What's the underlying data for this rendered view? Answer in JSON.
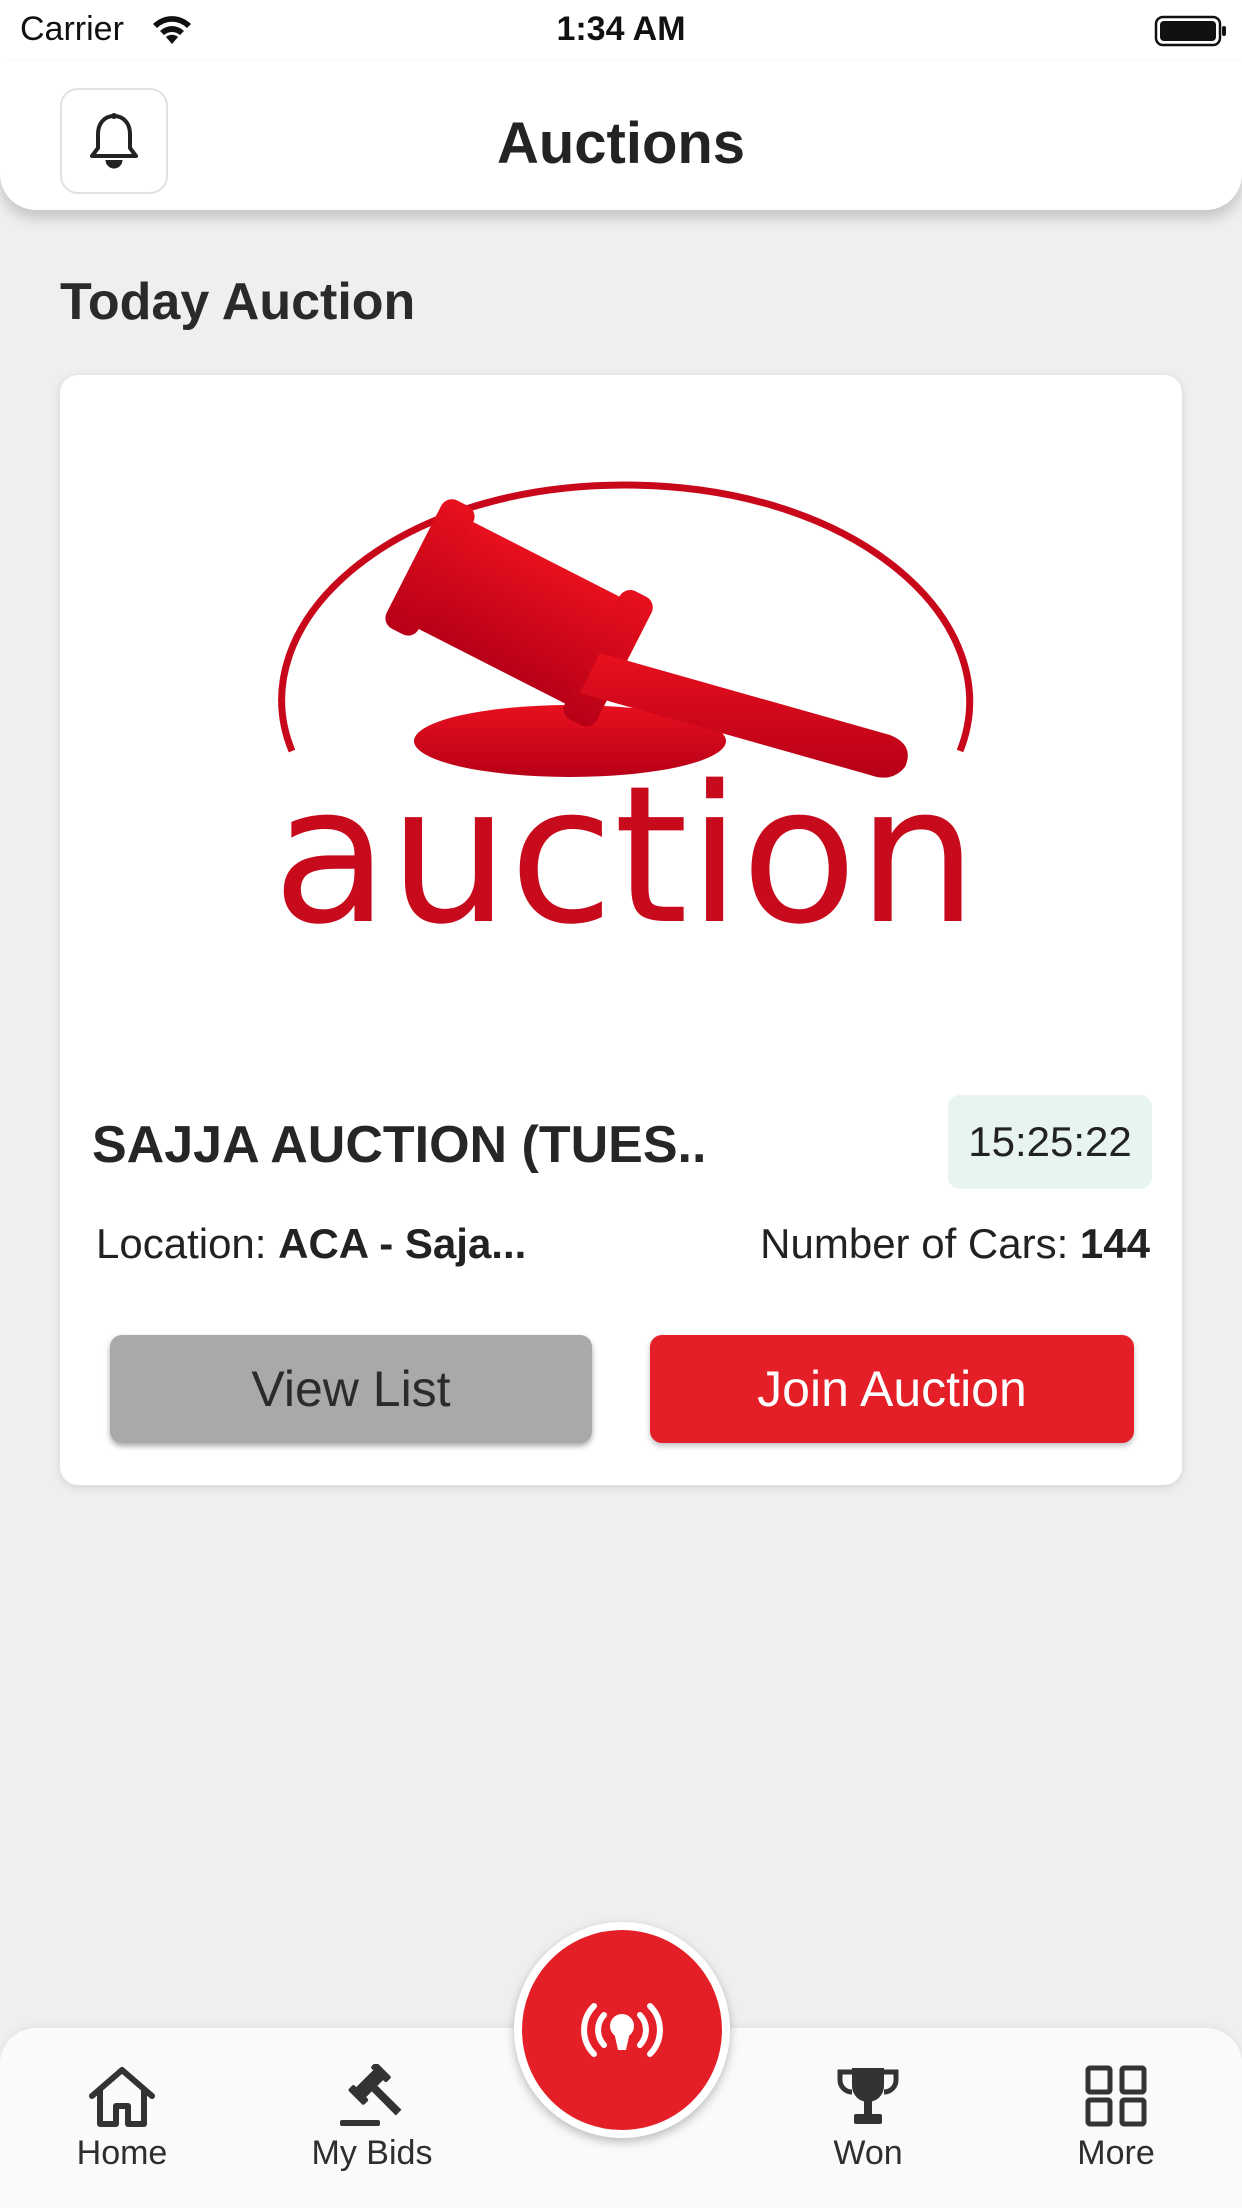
{
  "status_bar": {
    "carrier": "Carrier",
    "time": "1:34 AM"
  },
  "header": {
    "title": "Auctions"
  },
  "section": {
    "title": "Today Auction"
  },
  "auction_card": {
    "logo_text": "auction",
    "name": "SAJJA AUCTION (TUES..",
    "timer": "15:25:22",
    "location_label": "Location:",
    "location_value": "ACA - Saja...",
    "cars_label": "Number of Cars:",
    "cars_value": "144",
    "view_list_label": "View List",
    "join_label": "Join Auction"
  },
  "bottom_nav": {
    "items": [
      {
        "label": "Home",
        "icon": "home-icon"
      },
      {
        "label": "My Bids",
        "icon": "gavel-icon"
      },
      {
        "label": "Won",
        "icon": "trophy-icon"
      },
      {
        "label": "More",
        "icon": "grid-icon"
      }
    ],
    "center_icon": "live-broadcast-icon"
  },
  "colors": {
    "brand_red": "#e51f27",
    "background": "#eeeff1",
    "timer_bg": "#e8f4f1",
    "view_button": "#a9a9a9"
  }
}
